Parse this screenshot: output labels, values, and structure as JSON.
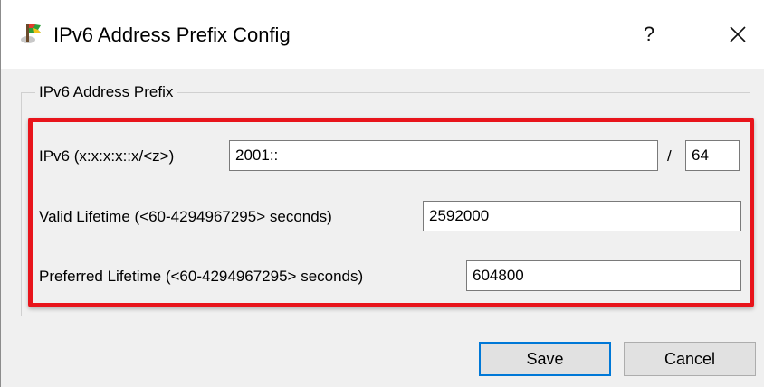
{
  "window": {
    "title": "IPv6 Address Prefix Config",
    "help_label": "?",
    "icon": "app-flag-icon"
  },
  "group": {
    "label": "IPv6 Address Prefix"
  },
  "fields": {
    "ipv6": {
      "label": "IPv6 (x:x:x:x::x/<z>)",
      "value": "2001::",
      "separator": "/",
      "prefix_length": "64"
    },
    "valid_lifetime": {
      "label": "Valid Lifetime (<60-4294967295> seconds)",
      "value": "2592000"
    },
    "preferred_lifetime": {
      "label": "Preferred Lifetime (<60-4294967295> seconds)",
      "value": "604800"
    }
  },
  "buttons": {
    "save": "Save",
    "cancel": "Cancel"
  },
  "colors": {
    "highlight": "#e8141b",
    "default_button_border": "#0078d7",
    "dialog_bg": "#f0f0f0"
  }
}
